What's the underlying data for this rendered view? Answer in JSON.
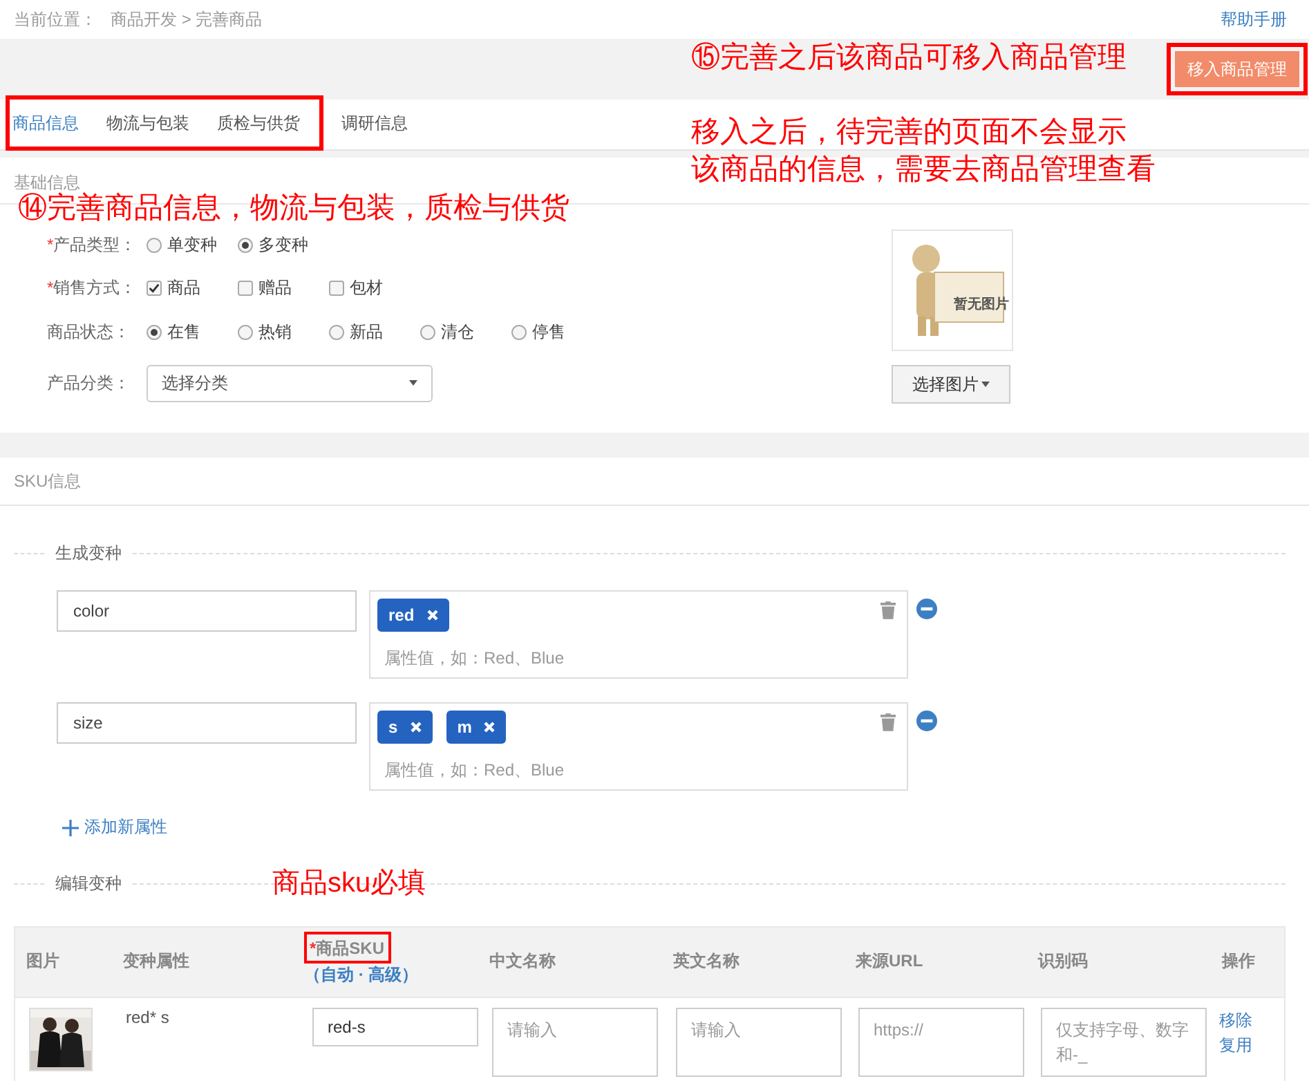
{
  "breadcrumb": {
    "label": "当前位置：",
    "path": "商品开发 > 完善商品"
  },
  "help_link": "帮助手册",
  "toolbar": {
    "note": "⑮完善之后该商品可移入商品管理",
    "button": {
      "label": "移入商品管理",
      "highlighted": true
    }
  },
  "tab_groups": [
    {
      "highlighted": true,
      "tabs": [
        {
          "label": "商品信息",
          "selected": true
        },
        {
          "label": "物流与包装",
          "selected": false
        },
        {
          "label": "质检与供货",
          "selected": false
        }
      ]
    },
    {
      "highlighted": false,
      "tabs": [
        {
          "label": "调研信息",
          "selected": false
        }
      ]
    }
  ],
  "tabs_note": [
    "移入之后，待完善的页面不会显示",
    "该商品的信息，需要去商品管理查看"
  ],
  "basic_info": {
    "title": "基础信息",
    "note": "⑭完善商品信息，物流与包装，质检与供货",
    "fields": [
      {
        "kind": "radio",
        "required_mark": "*",
        "label": "产品类型：",
        "options": [
          {
            "label": "单变种",
            "selected": false
          },
          {
            "label": "多变种",
            "selected": true
          }
        ]
      },
      {
        "kind": "checkbox",
        "required_mark": "*",
        "label": "销售方式：",
        "options": [
          {
            "label": "商品",
            "checked": true
          },
          {
            "label": "赠品",
            "checked": false
          },
          {
            "label": "包材",
            "checked": false
          }
        ]
      },
      {
        "kind": "radio",
        "label": "商品状态：",
        "options": [
          {
            "label": "在售",
            "selected": true
          },
          {
            "label": "热销",
            "selected": false
          },
          {
            "label": "新品",
            "selected": false
          },
          {
            "label": "清仓",
            "selected": false
          },
          {
            "label": "停售",
            "selected": false
          }
        ]
      },
      {
        "kind": "select",
        "label": "产品分类：",
        "value": "选择分类"
      }
    ],
    "image": {
      "caption": "暂无图片",
      "button": "选择图片"
    }
  },
  "sku_info": {
    "title": "SKU信息",
    "generate": {
      "title": "生成变种",
      "attributes": [
        {
          "name": "color",
          "values": [
            "red"
          ],
          "placeholder": "属性值，如：Red、Blue"
        },
        {
          "name": "size",
          "values": [
            "s",
            "m"
          ],
          "placeholder": "属性值，如：Red、Blue"
        }
      ],
      "add_link": "添加新属性"
    },
    "edit": {
      "title": "编辑变种",
      "note": "商品sku必填",
      "columns": [
        {
          "label": "图片"
        },
        {
          "label": "变种属性"
        },
        {
          "label": "商品SKU",
          "required_mark": "*",
          "link": "（自动 · 高级）",
          "highlighted": true
        },
        {
          "label": "中文名称"
        },
        {
          "label": "英文名称"
        },
        {
          "label": "来源URL"
        },
        {
          "label": "识别码"
        },
        {
          "label": "操作"
        }
      ],
      "rows": [
        {
          "image": {
            "kind": "picture"
          },
          "variant": "red* s",
          "sku": "red-s",
          "cn_name_placeholder": "请输入",
          "en_name_placeholder": "请输入",
          "url_placeholder": "https://",
          "code_placeholder": "仅支持字母、数字和-_",
          "actions": [
            "移除",
            "复用"
          ]
        }
      ]
    }
  }
}
